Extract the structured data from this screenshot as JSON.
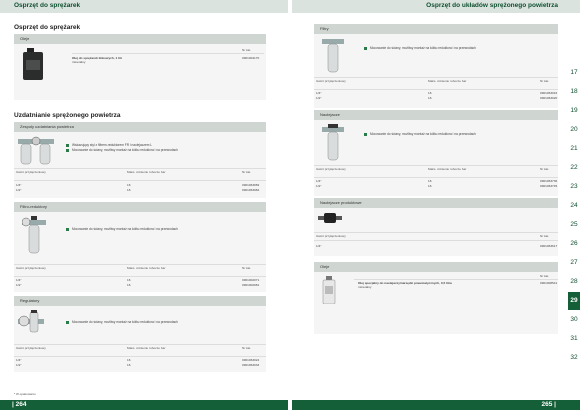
{
  "header": {
    "left_title": "Osprzęt do sprężarek",
    "right_title": "Osprzęt do układów sprężonego powietrza"
  },
  "footer": {
    "left_page": "| 264",
    "right_page": "265 |"
  },
  "left": {
    "section1_title": "Osprzęt do sprężarek",
    "oleje": {
      "head": "Oleje",
      "col_label": "Nr kat.",
      "product_name": "Olej do sprężarek tłokowych, 1 litr",
      "product_sub": "mineralny",
      "product_num": "0901004170"
    },
    "section2_title": "Uzdatnianie sprężonego powietrza",
    "zespoly": {
      "head": "Zespoły uzdatniania powietrza",
      "bullets": [
        "Wskazujący styl z filtrem-reduktorem FR i naolejaczem L",
        "Mocowanie do ściany, możliwy montaż na kółku reduktora i na przewodach"
      ],
      "cols": [
        "Gwint przyłączeniowy",
        "Maks. ciśnienie robocze bar",
        "Nr kat."
      ],
      "rows": [
        [
          "1/4\"",
          "16",
          "0901063969"
        ],
        [
          "1/2\"",
          "16",
          "0901063984"
        ]
      ]
    },
    "filtro": {
      "head": "Filtro-reduktory",
      "bullets": [
        "Mocowanie do ściany, możliwy montaż na kółku reduktora i na przewodach"
      ],
      "cols": [
        "Gwint przyłączeniowy",
        "Maks. ciśnienie robocze bar",
        "Nr kat."
      ],
      "rows": [
        [
          "1/4\"",
          "16",
          "0901002071"
        ],
        [
          "1/2\"",
          "16",
          "0901002081"
        ]
      ]
    },
    "regulatory": {
      "head": "Regulatory",
      "bullets": [
        "Mocowanie do ściany, możliwy montaż na kółku reduktora i na przewodach"
      ],
      "cols": [
        "Gwint przyłączeniowy",
        "Maks. ciśnienie robocze bar",
        "Nr kat."
      ],
      "rows": [
        [
          "1/4\"",
          "16",
          "0901063024"
        ],
        [
          "1/2\"",
          "16",
          "0901063033"
        ]
      ]
    },
    "footnote": "* W opakowaniu"
  },
  "right": {
    "filtry": {
      "head": "Filtry",
      "bullets": [
        "Mocowanie do ściany, możliwy montaż na kółku reduktora i na przewodach"
      ],
      "cols": [
        "Gwint przyłączeniowy",
        "Maks. ciśnienie robocze bar",
        "Nr kat."
      ],
      "rows": [
        [
          "1/4\"",
          "16",
          "0901063016"
        ],
        [
          "1/2\"",
          "16",
          "0901063020"
        ]
      ]
    },
    "naolejacze": {
      "head": "Naolejacze",
      "bullets": [
        "Mocowanie do ściany, możliwy montaż na kółku reduktora i na przewodach"
      ],
      "cols": [
        "Gwint przyłączeniowy",
        "Maks. ciśnienie robocze bar",
        "Nr kat."
      ],
      "rows": [
        [
          "1/4\"",
          "16",
          "0901063736"
        ],
        [
          "1/2\"",
          "16",
          "0901063745"
        ]
      ]
    },
    "naolejacze_prod": {
      "head": "Naolejacze produktowe",
      "cols": [
        "Gwint przyłączeniowy",
        "Nr kat."
      ],
      "rows": [
        [
          "1/4\"",
          "0901063617"
        ]
      ]
    },
    "oleje": {
      "head": "Oleje",
      "col_label": "Nr kat.",
      "product_name": "Olej specjalny do naolejaczy/narzędzi pneumatycznych, 0,5 litra",
      "product_sub": "mineralny",
      "product_num": "0901008541"
    }
  },
  "tabs": [
    "17",
    "18",
    "19",
    "20",
    "21",
    "22",
    "23",
    "24",
    "25",
    "26",
    "27",
    "28",
    "29",
    "30",
    "31",
    "32"
  ],
  "active_tab": "29",
  "colors": {
    "brand_green": "#155f38",
    "panel_head": "#cfd5d1",
    "panel_bg": "#f4f5f4"
  }
}
